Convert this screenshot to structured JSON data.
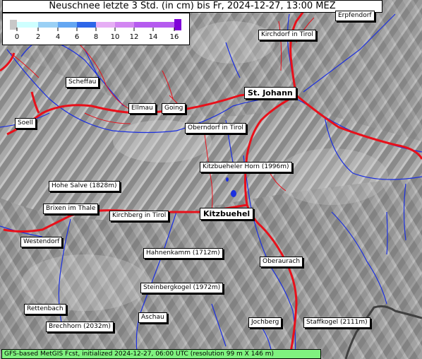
{
  "title": "Neuschnee letzte 3 Std. (in cm) bis Fr, 2024-12-27, 13:00 MEZ",
  "legend": {
    "ticks": [
      "0",
      "2",
      "4",
      "6",
      "8",
      "10",
      "12",
      "14",
      "16"
    ],
    "colors": [
      "#c8c8c8",
      "#ceffff",
      "#9ad0f5",
      "#63a6f2",
      "#2d66e8",
      "#e6aef5",
      "#d286f2",
      "#b55bef",
      "#7f00d9"
    ]
  },
  "places": {
    "erpfendorf": "Erpfendorf",
    "kirchdorf": "Kirchdorf in Tirol",
    "scheffau": "Scheffau",
    "st_johann": "St. Johann",
    "ellmau": "Ellmau",
    "going": "Going",
    "soell": "Soell",
    "oberndorf": "Oberndorf in Tirol",
    "kitzbueheler_horn": "Kitzbueheler Horn (1996m)",
    "hohe_salve": "Hohe Salve (1828m)",
    "brixen": "Brixen im Thale",
    "kirchberg": "Kirchberg in Tirol",
    "kitzbuehel": "Kitzbuehel",
    "westendorf": "Westendorf",
    "hahnenkamm": "Hahnenkamm (1712m)",
    "oberaurach": "Oberaurach",
    "steinbergkogel": "Steinbergkogel (1972m)",
    "rettenbach": "Rettenbach",
    "aschau": "Aschau",
    "brechhorn": "Brechhorn (2032m)",
    "jochberg": "Jochberg",
    "staffkogel": "Staffkogel (2111m)"
  },
  "footer": "GFS-based MetGIS Fcst, initialized 2024-12-27, 06:00 UTC  (resolution 99 m X 146 m)",
  "colors": {
    "road": "#e8101a",
    "river": "#1b2fe0",
    "border": "#404040",
    "footer_bg": "#7ff27f"
  }
}
